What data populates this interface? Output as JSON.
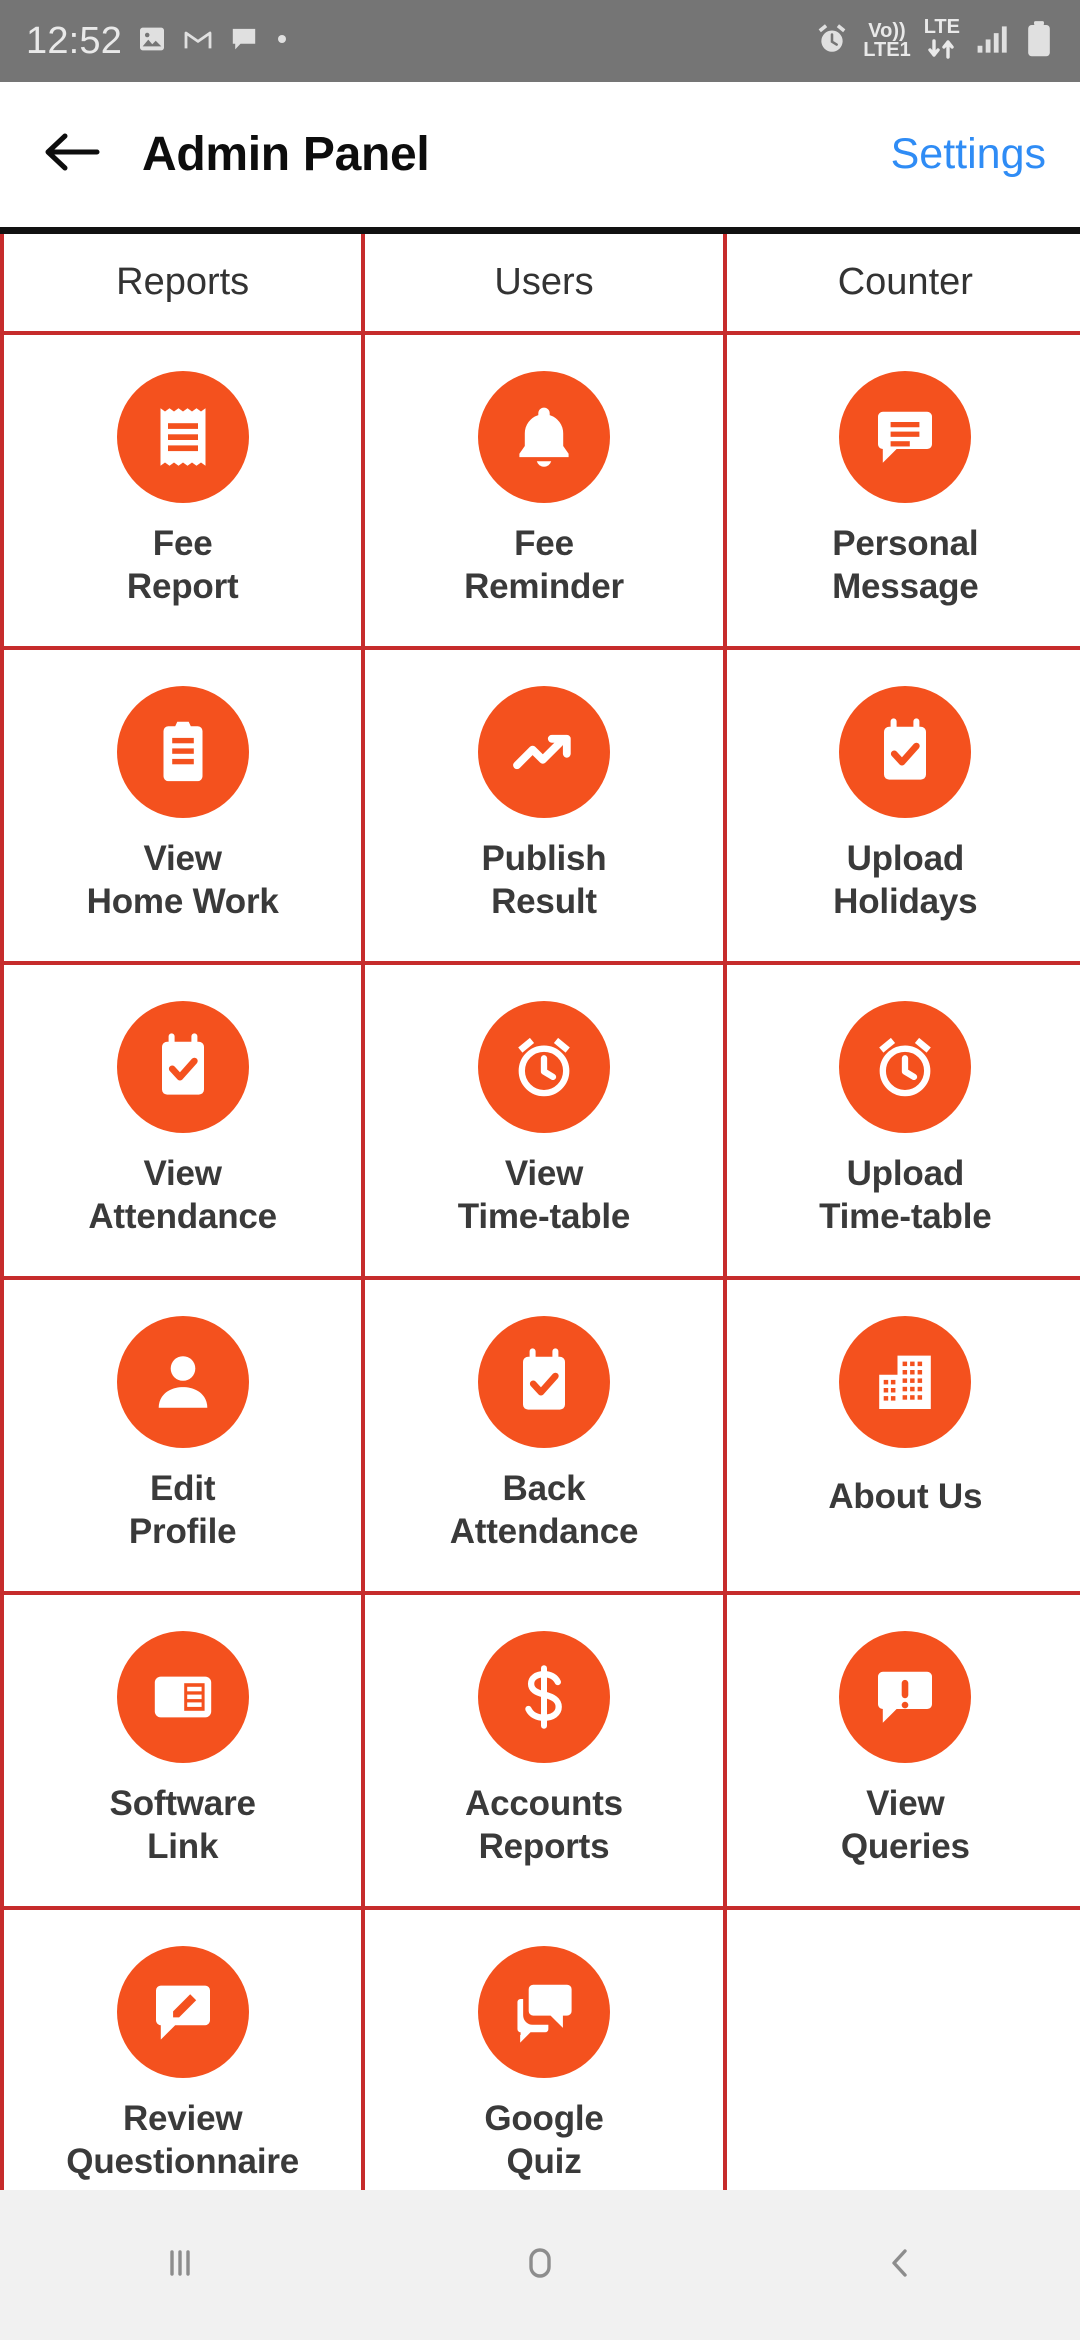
{
  "status_bar": {
    "clock": "12:52",
    "left_icons": [
      "image-icon",
      "gmail-icon",
      "message-icon",
      "dot-icon"
    ],
    "right_icons": [
      "alarm-icon",
      "volte-icon",
      "lte-data-icon",
      "signal-icon",
      "battery-icon"
    ],
    "volte_top": "Vo))",
    "volte_bottom": "LTE1",
    "lte_label": "LTE",
    "background": "#757575"
  },
  "app_bar": {
    "back_icon": "back-arrow-icon",
    "title": "Admin Panel",
    "settings_label": "Settings",
    "settings_color": "#2f8cf5"
  },
  "grid": {
    "border_color": "#c62b2b",
    "accent_color": "#f4511e",
    "headers": [
      "Reports",
      "Users",
      "Counter"
    ],
    "rows": [
      [
        {
          "label": "Fee\nReport",
          "icon": "receipt-icon"
        },
        {
          "label": "Fee\nReminder",
          "icon": "bell-icon"
        },
        {
          "label": "Personal\nMessage",
          "icon": "chat-lines-icon"
        }
      ],
      [
        {
          "label": "View\nHome Work",
          "icon": "clipboard-icon"
        },
        {
          "label": "Publish\nResult",
          "icon": "trending-up-icon"
        },
        {
          "label": "Upload\nHolidays",
          "icon": "calendar-check-icon"
        }
      ],
      [
        {
          "label": "View\nAttendance",
          "icon": "calendar-check-icon"
        },
        {
          "label": "View\nTime-table",
          "icon": "alarm-clock-icon"
        },
        {
          "label": "Upload\nTime-table",
          "icon": "alarm-clock-icon"
        }
      ],
      [
        {
          "label": "Edit\nProfile",
          "icon": "person-icon"
        },
        {
          "label": "Back\nAttendance",
          "icon": "calendar-check-icon"
        },
        {
          "label": "About Us",
          "icon": "building-icon"
        }
      ],
      [
        {
          "label": "Software\nLink",
          "icon": "article-icon"
        },
        {
          "label": "Accounts\nReports",
          "icon": "dollar-icon"
        },
        {
          "label": "View\nQueries",
          "icon": "chat-alert-icon"
        }
      ],
      [
        {
          "label": "Review\nQuestionnaire",
          "icon": "rate-review-icon"
        },
        {
          "label": "Google\nQuiz",
          "icon": "forum-icon"
        },
        {
          "label": "",
          "icon": ""
        }
      ]
    ]
  },
  "nav_bar": {
    "recents_icon": "recents-icon",
    "home_icon": "home-icon",
    "back_icon": "nav-back-icon",
    "background": "#f1f1f1"
  }
}
